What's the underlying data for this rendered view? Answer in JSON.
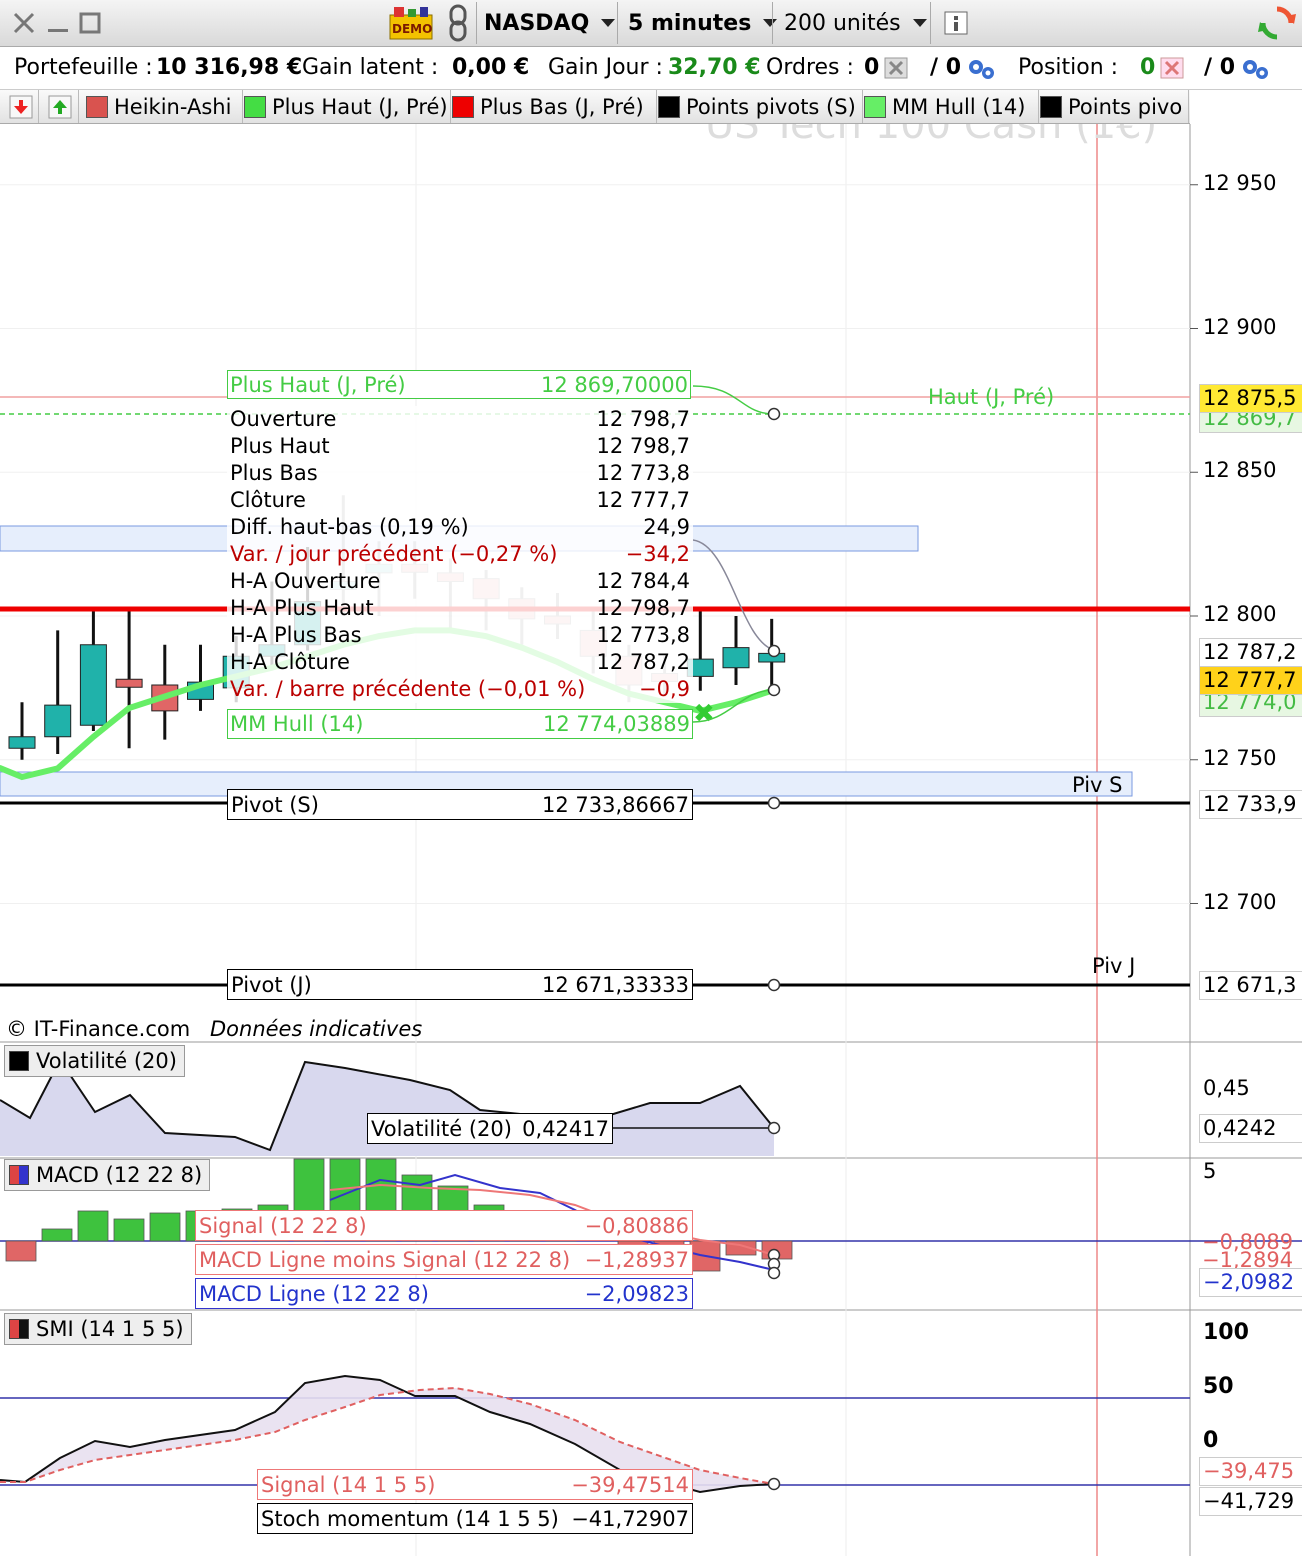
{
  "toolbar": {
    "symbol": "NASDAQ",
    "interval": "5 minutes",
    "units": "200 unités",
    "demo_badge": "DEMO"
  },
  "account": {
    "portfolio_label": "Portefeuille :",
    "portfolio_value": "10 316,98 €",
    "latent_label": "Gain latent :",
    "latent_value": "0,00 €",
    "day_label": "Gain Jour :",
    "day_value": "32,70 €",
    "orders_label": "Ordres :",
    "orders_value": "0",
    "orders_slash": "/ 0",
    "position_label": "Position :",
    "position_value": "0",
    "position_slash": "/ 0"
  },
  "tabs": [
    {
      "label": "Heikin-Ashi",
      "color": "#d9534f"
    },
    {
      "label": "Plus Haut (J, Pré)",
      "color": "#44dd44"
    },
    {
      "label": "Plus Bas (J, Pré)",
      "color": "#ee0000"
    },
    {
      "label": "Points pivots (S)",
      "color": "#000000"
    },
    {
      "label": "MM Hull (14)",
      "color": "#66ee66"
    },
    {
      "label": "Points pivo",
      "color": "#000000"
    }
  ],
  "chart": {
    "watermark": "US Tech 100 Cash (1€)",
    "price_axis": [
      "12 950",
      "12 900",
      "12 850",
      "12 800",
      "12 750",
      "12 700"
    ],
    "axis_badges": {
      "high_prev": "12 875,5",
      "high_prev2": "12 869,7",
      "last_ha": "12 787,2",
      "last": "12 777,7",
      "hull": "12 774,0",
      "pivot_s": "12 733,9",
      "pivot_j": "12 671,3"
    },
    "line_labels": {
      "haut": "Haut (J, Pré)",
      "piv_s": "Piv S",
      "piv_j": "Piv J"
    },
    "copyright": "© IT-Finance.com",
    "disclaimer": "Données indicatives",
    "tooltip": {
      "high_label": "Plus Haut (J, Pré)",
      "high_value": "12 869,70000",
      "rows": [
        {
          "label": "Ouverture",
          "value": "12 798,7",
          "red": false
        },
        {
          "label": "Plus Haut",
          "value": "12 798,7",
          "red": false
        },
        {
          "label": "Plus Bas",
          "value": "12 773,8",
          "red": false
        },
        {
          "label": "Clôture",
          "value": "12 777,7",
          "red": false
        },
        {
          "label": "Diff. haut-bas (0,19 %)",
          "value": "24,9",
          "red": false
        },
        {
          "label": "Var. / jour précédent (−0,27 %)",
          "value": "−34,2",
          "red": true
        },
        {
          "label": "H-A Ouverture",
          "value": "12 784,4",
          "red": false
        },
        {
          "label": "H-A Plus Haut",
          "value": "12 798,7",
          "red": false
        },
        {
          "label": "H-A Plus Bas",
          "value": "12 773,8",
          "red": false
        },
        {
          "label": "H-A Clôture",
          "value": "12 787,2",
          "red": false
        },
        {
          "label": "Var. / barre précédente (−0,01 %)",
          "value": "−0,9",
          "red": true
        }
      ],
      "hull_label": "MM Hull (14)",
      "hull_value": "12 774,03889",
      "pivot_s_label": "Pivot (S)",
      "pivot_s_value": "12 733,86667",
      "pivot_j_label": "Pivot (J)",
      "pivot_j_value": "12 671,33333"
    }
  },
  "volatility": {
    "tag": "Volatilité (20)",
    "label": "Volatilité (20)",
    "value": "0,42417",
    "axis": "0,45",
    "badge": "0,4242"
  },
  "macd": {
    "tag": "MACD (12 22 8)",
    "signal_label": "Signal (12 22 8)",
    "signal_value": "−0,80886",
    "diff_label": "MACD Ligne moins Signal (12 22 8)",
    "diff_value": "−1,28937",
    "line_label": "MACD Ligne (12 22 8)",
    "line_value": "−2,09823",
    "axis": "5",
    "badge_signal": "−0,8089",
    "badge_diff": "−1,2894",
    "badge_line": "−2,0982"
  },
  "smi": {
    "tag": "SMI (14 1 5 5)",
    "signal_label": "Signal (14 1 5 5)",
    "signal_value": "−39,47514",
    "stoch_label": "Stoch momentum (14 1 5 5)",
    "stoch_value": "−41,72907",
    "axis": [
      "100",
      "50",
      "0"
    ],
    "badge_signal": "−39,475",
    "badge_stoch": "−41,729"
  },
  "candles": [
    {
      "o": 12754,
      "c": 12758,
      "h": 12770,
      "l": 12750,
      "bull": true
    },
    {
      "o": 12758,
      "c": 12769,
      "h": 12795,
      "l": 12752,
      "bull": true
    },
    {
      "o": 12762,
      "c": 12790,
      "h": 12802,
      "l": 12760,
      "bull": true
    },
    {
      "o": 12778,
      "c": 12776,
      "h": 12802,
      "l": 12754,
      "bull": false
    },
    {
      "o": 12776,
      "c": 12767,
      "h": 12790,
      "l": 12757,
      "bull": false
    },
    {
      "o": 12771,
      "c": 12777,
      "h": 12790,
      "l": 12767,
      "bull": true
    },
    {
      "o": 12775,
      "c": 12786,
      "h": 12793,
      "l": 12770,
      "bull": true
    },
    {
      "o": 12786,
      "c": 12790,
      "h": 12812,
      "l": 12782,
      "bull": true
    },
    {
      "o": 12790,
      "c": 12805,
      "h": 12824,
      "l": 12788,
      "bull": true
    },
    {
      "o": 12812,
      "c": 12812,
      "h": 12842,
      "l": 12800,
      "bull": true
    },
    {
      "o": 12815,
      "c": 12818,
      "h": 12826,
      "l": 12800,
      "bull": true
    },
    {
      "o": 12818,
      "c": 12817,
      "h": 12826,
      "l": 12806,
      "bull": false
    },
    {
      "o": 12815,
      "c": 12812,
      "h": 12820,
      "l": 12795,
      "bull": false
    },
    {
      "o": 12813,
      "c": 12806,
      "h": 12816,
      "l": 12795,
      "bull": false
    },
    {
      "o": 12806,
      "c": 12799,
      "h": 12810,
      "l": 12790,
      "bull": false
    },
    {
      "o": 12800,
      "c": 12798,
      "h": 12808,
      "l": 12792,
      "bull": false
    },
    {
      "o": 12795,
      "c": 12786,
      "h": 12802,
      "l": 12780,
      "bull": false
    },
    {
      "o": 12786,
      "c": 12776,
      "h": 12790,
      "l": 12770,
      "bull": false
    },
    {
      "o": 12780,
      "c": 12778,
      "h": 12786,
      "l": 12772,
      "bull": false
    },
    {
      "o": 12779,
      "c": 12785,
      "h": 12802,
      "l": 12774,
      "bull": true
    },
    {
      "o": 12782,
      "c": 12789,
      "h": 12800,
      "l": 12776,
      "bull": true
    },
    {
      "o": 12784,
      "c": 12787,
      "h": 12799,
      "l": 12774,
      "bull": true
    }
  ],
  "hull": [
    12744,
    12747,
    12758,
    12768,
    12772,
    12776,
    12779,
    12782,
    12786,
    12790,
    12793,
    12795,
    12795,
    12793,
    12789,
    12784,
    12778,
    12773,
    12770,
    12767,
    12770,
    12774
  ],
  "colors": {
    "bull": "#20b2aa",
    "bear": "#e06666",
    "hull": "#66ee66",
    "prev_low": "#ee0000",
    "prev_high": "#44cc44"
  }
}
